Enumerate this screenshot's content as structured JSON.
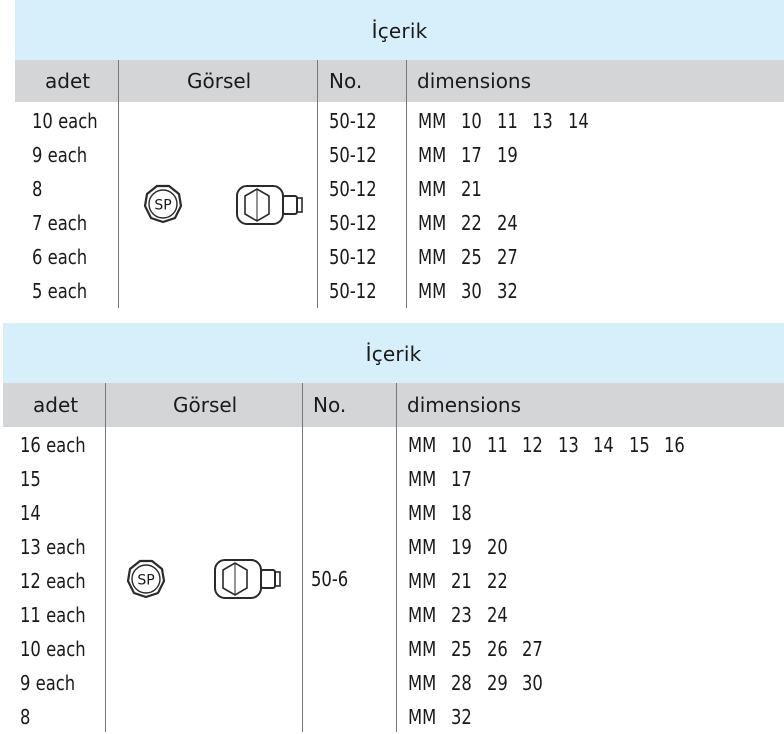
{
  "tables": [
    {
      "title": "İçerik",
      "headers": {
        "qty": "adet",
        "image": "Görsel",
        "no": "No.",
        "dims": "dimensions"
      },
      "image_badge": "SP",
      "rows": [
        {
          "qty": "10 each",
          "no": "50-12",
          "unit": "MM",
          "sizes": [
            "10",
            "11",
            "13",
            "14"
          ]
        },
        {
          "qty": "9 each",
          "no": "50-12",
          "unit": "MM",
          "sizes": [
            "17",
            "19"
          ]
        },
        {
          "qty": "8",
          "no": "50-12",
          "unit": "MM",
          "sizes": [
            "21"
          ]
        },
        {
          "qty": "7 each",
          "no": "50-12",
          "unit": "MM",
          "sizes": [
            "22",
            "24"
          ]
        },
        {
          "qty": "6 each",
          "no": "50-12",
          "unit": "MM",
          "sizes": [
            "25",
            "27"
          ]
        },
        {
          "qty": "5 each",
          "no": "50-12",
          "unit": "MM",
          "sizes": [
            "30",
            "32"
          ]
        }
      ]
    },
    {
      "title": "İçerik",
      "headers": {
        "qty": "adet",
        "image": "Görsel",
        "no": "No.",
        "dims": "dimensions"
      },
      "image_badge": "SP",
      "part_no": "50-6",
      "rows": [
        {
          "qty": "16 each",
          "unit": "MM",
          "sizes": [
            "10",
            "11",
            "12",
            "13",
            "14",
            "15",
            "16"
          ]
        },
        {
          "qty": "15",
          "unit": "MM",
          "sizes": [
            "17"
          ]
        },
        {
          "qty": "14",
          "unit": "MM",
          "sizes": [
            "18"
          ]
        },
        {
          "qty": "13 each",
          "unit": "MM",
          "sizes": [
            "19",
            "20"
          ]
        },
        {
          "qty": "12 each",
          "unit": "MM",
          "sizes": [
            "21",
            "22"
          ]
        },
        {
          "qty": "11 each",
          "unit": "MM",
          "sizes": [
            "23",
            "24"
          ]
        },
        {
          "qty": "10 each",
          "unit": "MM",
          "sizes": [
            "25",
            "26",
            "27"
          ]
        },
        {
          "qty": "9 each",
          "unit": "MM",
          "sizes": [
            "28",
            "29",
            "30"
          ]
        },
        {
          "qty": "8",
          "unit": "MM",
          "sizes": [
            "32"
          ]
        }
      ]
    }
  ]
}
